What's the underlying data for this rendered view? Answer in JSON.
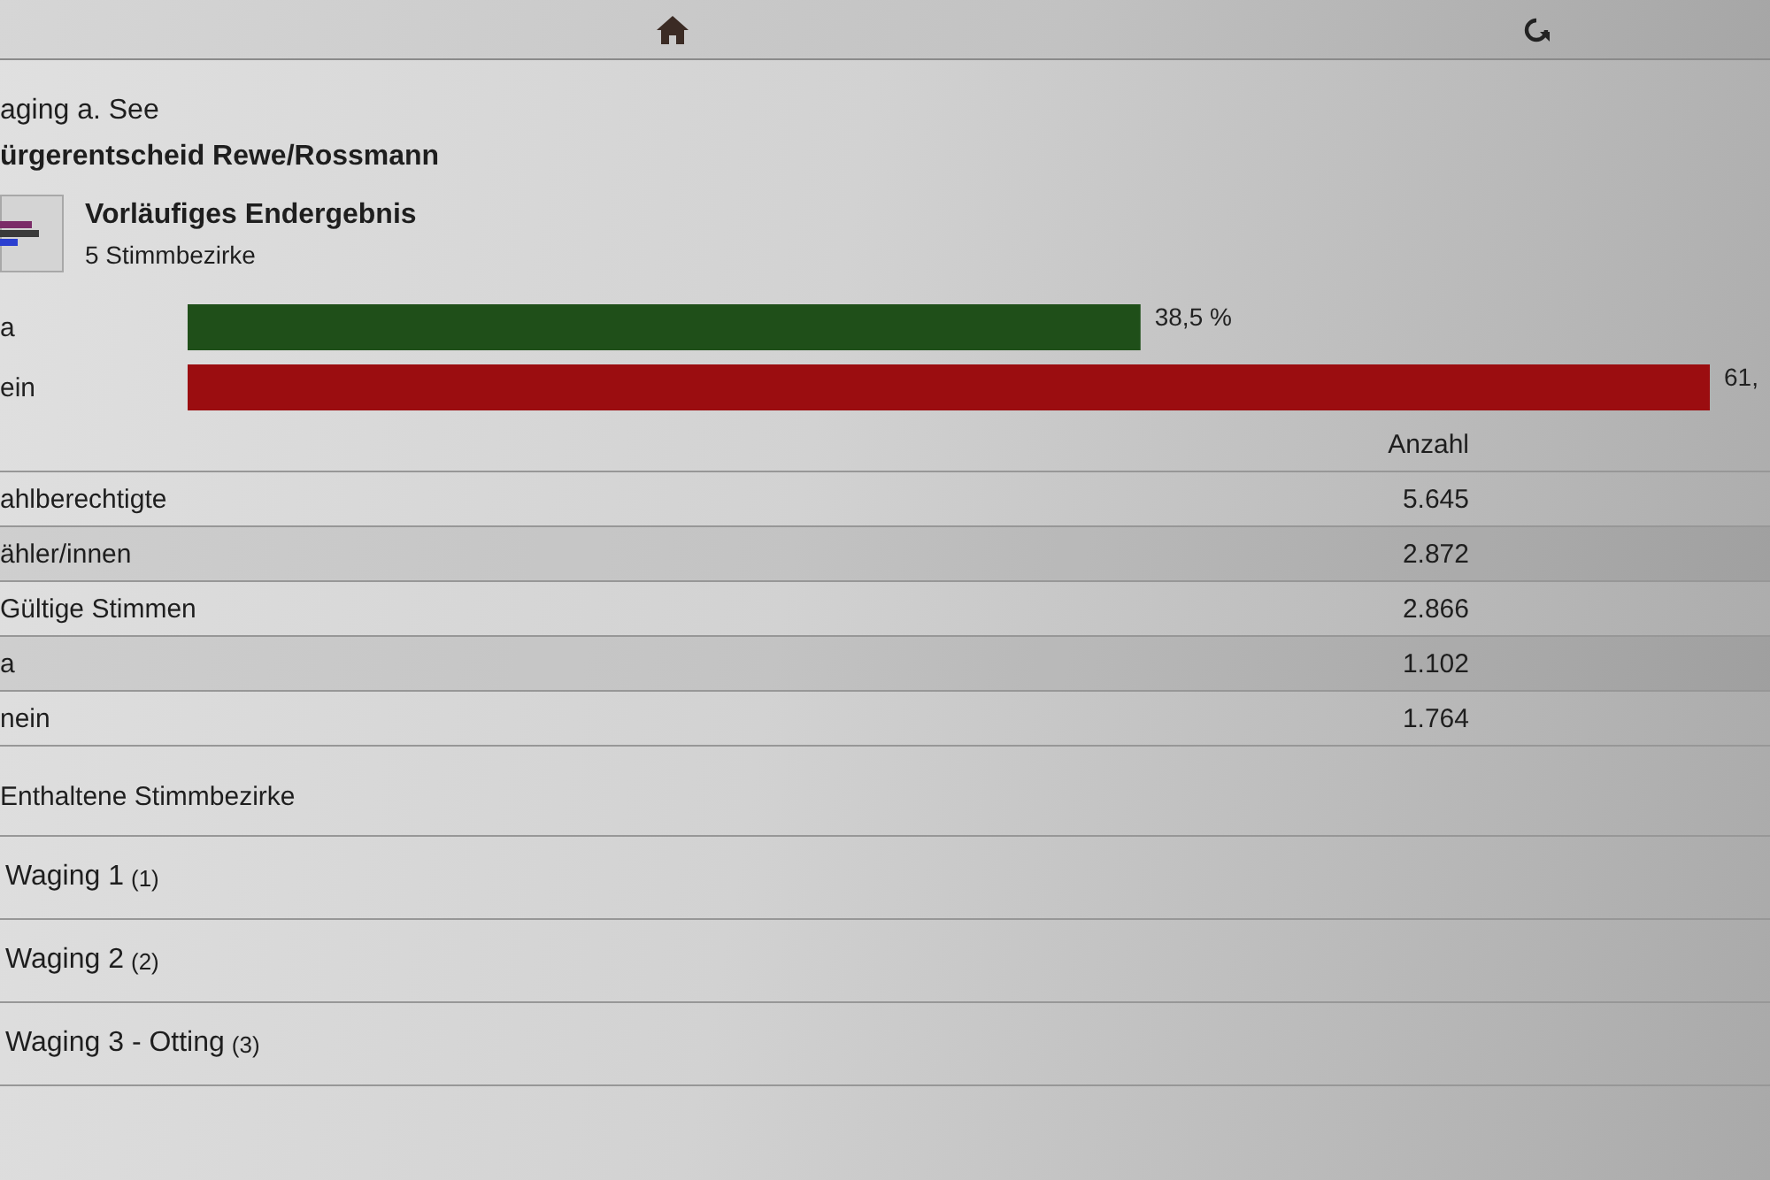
{
  "header": {
    "place": "aging a. See",
    "title": "ürgerentscheid Rewe/Rossmann"
  },
  "result": {
    "title": "Vorläufiges Endergebnis",
    "subtitle": "5 Stimmbezirke",
    "chart_data": {
      "type": "bar",
      "orientation": "horizontal",
      "categories": [
        "a",
        "ein"
      ],
      "values": [
        38.5,
        61.5
      ],
      "colors": [
        "#1f4f19",
        "#9b0d10"
      ],
      "value_labels": [
        "38,5 %",
        "61,"
      ]
    }
  },
  "table": {
    "value_heading": "Anzahl",
    "rows": [
      {
        "label": "ahlberechtigte",
        "value": "5.645"
      },
      {
        "label": "ähler/innen",
        "value": "2.872"
      },
      {
        "label": "Gültige Stimmen",
        "value": "2.866"
      },
      {
        "label": "a",
        "value": "1.102"
      },
      {
        "label": "nein",
        "value": "1.764"
      }
    ]
  },
  "districts": {
    "title": "Enthaltene Stimmbezirke",
    "items": [
      {
        "name": "Waging 1",
        "number": "(1)"
      },
      {
        "name": "Waging 2",
        "number": "(2)"
      },
      {
        "name": "Waging 3 - Otting",
        "number": "(3)"
      }
    ]
  }
}
